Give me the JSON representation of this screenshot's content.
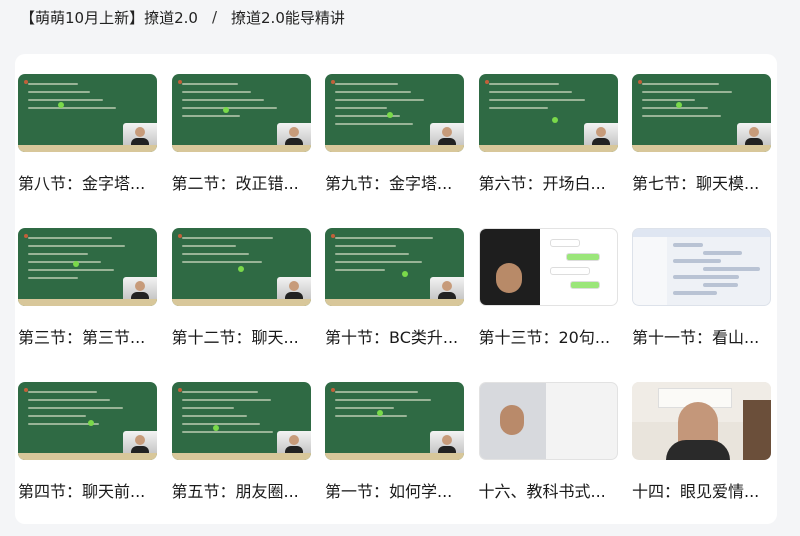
{
  "breadcrumb": {
    "root": "【萌萌10月上新】撩道2.0",
    "separator": "/",
    "current": "撩道2.0能导精讲"
  },
  "lessons": [
    {
      "title": "第八节：金字塔...",
      "thumb": "board"
    },
    {
      "title": "第二节：改正错...",
      "thumb": "board"
    },
    {
      "title": "第九节：金字塔...",
      "thumb": "board"
    },
    {
      "title": "第六节：开场白...",
      "thumb": "board"
    },
    {
      "title": "第七节：聊天模...",
      "thumb": "board"
    },
    {
      "title": "第三节：第三节...",
      "thumb": "board"
    },
    {
      "title": "第十二节：聊天...",
      "thumb": "board"
    },
    {
      "title": "第十节：BC类升...",
      "thumb": "board"
    },
    {
      "title": "第十三节：20句...",
      "thumb": "chat"
    },
    {
      "title": "第十一节：看山...",
      "thumb": "app"
    },
    {
      "title": "第四节：聊天前...",
      "thumb": "board"
    },
    {
      "title": "第五节：朋友圈...",
      "thumb": "board"
    },
    {
      "title": "第一节：如何学...",
      "thumb": "board"
    },
    {
      "title": "十六、教科书式...",
      "thumb": "cam2"
    },
    {
      "title": "十四：眼见爱情...",
      "thumb": "portrait"
    }
  ]
}
